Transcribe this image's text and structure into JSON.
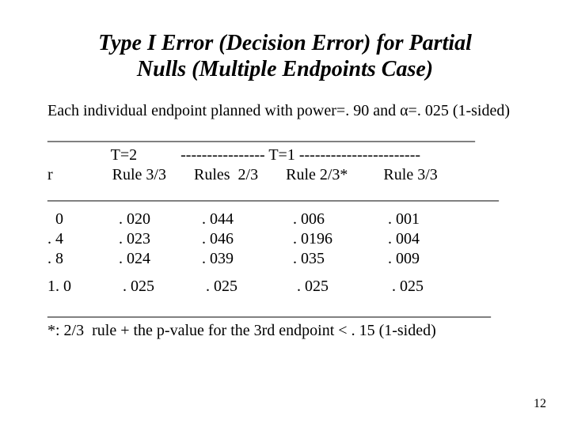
{
  "title_l1": "Type I Error (Decision Error) for Partial",
  "title_l2": "Nulls (Multiple Endpoints Case)",
  "intro": "Each individual endpoint planned with power=. 90 and α=. 025 (1-sided)",
  "rule1": "______________________________________________________",
  "head1": "                T=2           ---------------- T=1 -----------------------",
  "head2": "r               Rule 3/3       Rules  2/3       Rule 2/3*         Rule 3/3",
  "rule2": "_________________________________________________________",
  "row0": "  0              . 020             . 044               . 006                . 001",
  "row1": ". 4              . 023             . 046               . 0196              . 004",
  "row2": ". 8              . 024             . 039               . 035                . 009",
  "row3": "1. 0             . 025             . 025               . 025                . 025",
  "rule3": "________________________________________________________",
  "footnote": "*: 2/3  rule + the p-value for the 3rd endpoint < . 15 (1-sided)",
  "pagenum": "12",
  "chart_data": {
    "type": "table",
    "title": "Type I Error (Decision Error) for Partial Nulls (Multiple Endpoints Case)",
    "note": "Each individual endpoint planned with power=.90 and alpha=.025 (1-sided)",
    "columns": [
      {
        "group": "T=2",
        "name": "Rule 3/3"
      },
      {
        "group": "T=1",
        "name": "Rules 2/3"
      },
      {
        "group": "T=1",
        "name": "Rule 2/3*"
      },
      {
        "group": "T=1",
        "name": "Rule 3/3"
      }
    ],
    "rows": [
      {
        "r": 0.0,
        "values": [
          0.02,
          0.044,
          0.006,
          0.001
        ]
      },
      {
        "r": 0.4,
        "values": [
          0.023,
          0.046,
          0.0196,
          0.004
        ]
      },
      {
        "r": 0.8,
        "values": [
          0.024,
          0.039,
          0.035,
          0.009
        ]
      },
      {
        "r": 1.0,
        "values": [
          0.025,
          0.025,
          0.025,
          0.025
        ]
      }
    ],
    "footnote": "*: 2/3 rule + the p-value for the 3rd endpoint < .15 (1-sided)"
  }
}
